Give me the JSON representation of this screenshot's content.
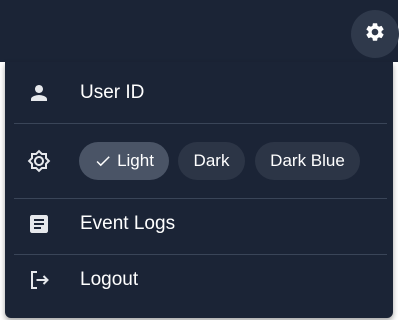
{
  "header": {
    "settings_icon": "gear-icon"
  },
  "menu": {
    "user": {
      "icon": "person-icon",
      "label": "User ID"
    },
    "theme": {
      "icon": "brightness-icon",
      "options": [
        {
          "label": "Light",
          "selected": true,
          "check_icon": "check-icon"
        },
        {
          "label": "Dark",
          "selected": false
        },
        {
          "label": "Dark Blue",
          "selected": false
        }
      ]
    },
    "event_logs": {
      "icon": "document-icon",
      "label": "Event Logs"
    },
    "logout": {
      "icon": "logout-icon",
      "label": "Logout"
    }
  },
  "colors": {
    "background": "#1b2436",
    "chip": "#2c3546",
    "chip_selected": "#4a5466",
    "settings_button": "#2f394b",
    "divider": "#3a4558",
    "text": "#ffffff"
  }
}
